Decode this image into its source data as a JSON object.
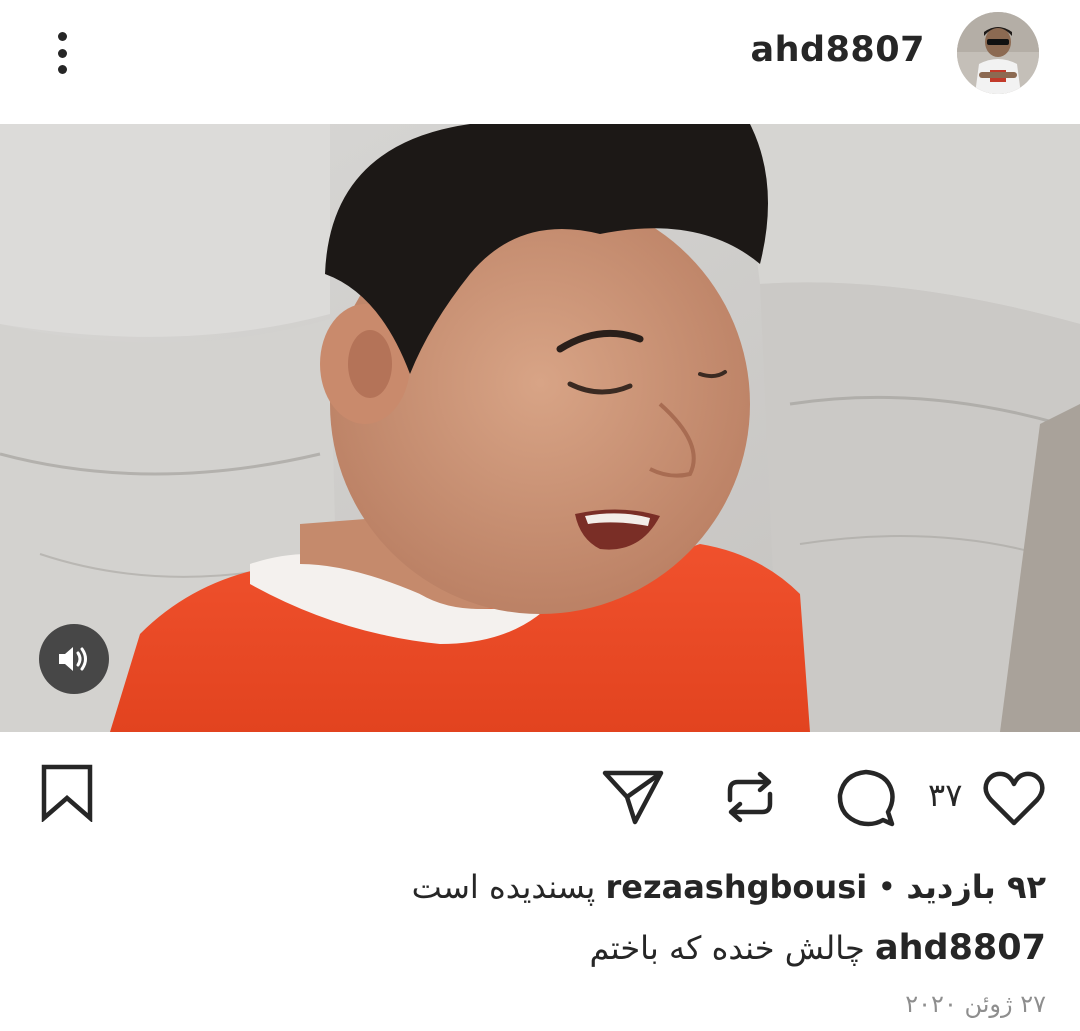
{
  "header": {
    "username": "ahd8807",
    "more_icon": "more-vertical-icon"
  },
  "media": {
    "type": "video",
    "mute_icon": "speaker-icon"
  },
  "actions": {
    "like_icon": "heart-icon",
    "like_count": "۳۷",
    "comment_icon": "comment-icon",
    "repost_icon": "repost-icon",
    "share_icon": "send-icon",
    "save_icon": "bookmark-icon"
  },
  "stats": {
    "views": "۹۲ بازدید",
    "separator": "•",
    "liked_by_user": "rezaashgbousi",
    "liked_suffix": "پسندیده است"
  },
  "caption": {
    "username": "ahd8807",
    "text": "چالش خنده که باختم"
  },
  "date": "۲۷ ژوئن ۲۰۲۰"
}
